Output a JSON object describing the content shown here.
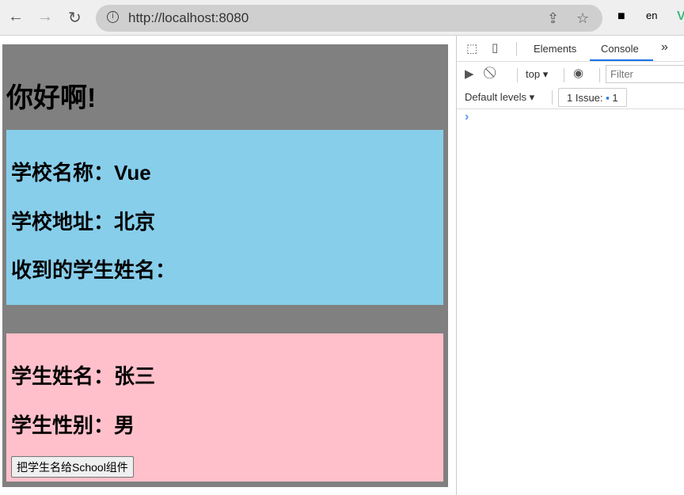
{
  "browser": {
    "url": "http://localhost:8080",
    "icons": [
      "back-arrow-icon",
      "forward-arrow-icon",
      "reload-icon",
      "info-icon",
      "share-icon",
      "star-icon",
      "extension-icon",
      "translate-extension-icon",
      "vue-devtools-icon"
    ]
  },
  "app": {
    "title": "你好啊!",
    "school": {
      "name": "学校名称：Vue",
      "address": "学校地址：北京",
      "received": "收到的学生姓名："
    },
    "student": {
      "name": "学生姓名：张三",
      "sex": "学生性别：男",
      "button": "把学生名给School组件"
    },
    "colors": {
      "outer": "#808080",
      "school": "#87ceeb",
      "student": "#ffc0cb"
    }
  },
  "devtools": {
    "tabs": [
      "Elements",
      "Console"
    ],
    "active_tab": "Console",
    "more": "»",
    "context": "top",
    "filter_placeholder": "Filter",
    "levels": "Default levels",
    "issues_label": "1 Issue:",
    "issues_count": "1",
    "prompt": "›"
  }
}
